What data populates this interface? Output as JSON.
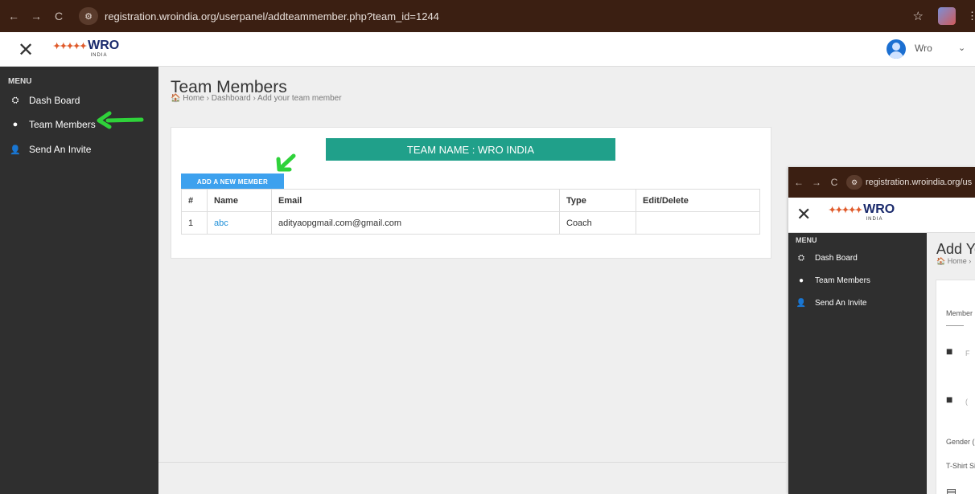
{
  "browser": {
    "url": "registration.wroindia.org/userpanel/addteammember.php?team_id=1244",
    "back_icon": "←",
    "forward_icon": "→",
    "reload_icon": "C",
    "site_icon": "⚙",
    "star_icon": "☆",
    "menu_icon": "⋮"
  },
  "header": {
    "close_icon": "✕",
    "logo_text": "WRO",
    "logo_sub": "INDIA",
    "user_name": "Wro",
    "user_caret": "⌄"
  },
  "sidebar": {
    "menu_title": "MENU",
    "items": [
      {
        "label": "Dash Board",
        "icon": "⛭"
      },
      {
        "label": "Team Members",
        "icon": "●"
      },
      {
        "label": "Send An Invite",
        "icon": "👤"
      }
    ]
  },
  "page": {
    "title": "Team Members",
    "breadcrumb": "🏠 Home  ›  Dashboard  ›  Add your team member"
  },
  "team": {
    "banner": "TEAM NAME : WRO INDIA",
    "add_button": "ADD A NEW MEMBER"
  },
  "table": {
    "headers": [
      "#",
      "Name",
      "Email",
      "Type",
      "Edit/Delete"
    ],
    "rows": [
      {
        "num": "1",
        "name": "abc",
        "email": "adityaopgmail.com@gmail.com",
        "type": "Coach",
        "actions": ""
      }
    ]
  },
  "overlay": {
    "url": "registration.wroindia.org/us",
    "page_title": "Add Yo",
    "breadcrumb": "🏠 Home ›",
    "member_label": "Member",
    "gender_label": "Gender (",
    "tshirt_label": "T-Shirt Si",
    "field_hint_1": "F",
    "field_hint_2": "("
  },
  "colors": {
    "accent_teal": "#20a08a",
    "button_blue": "#3da1ee",
    "link_blue": "#1e8fd8",
    "sidebar_bg": "#2f2f2f",
    "arrow_green": "#2fd23a"
  }
}
